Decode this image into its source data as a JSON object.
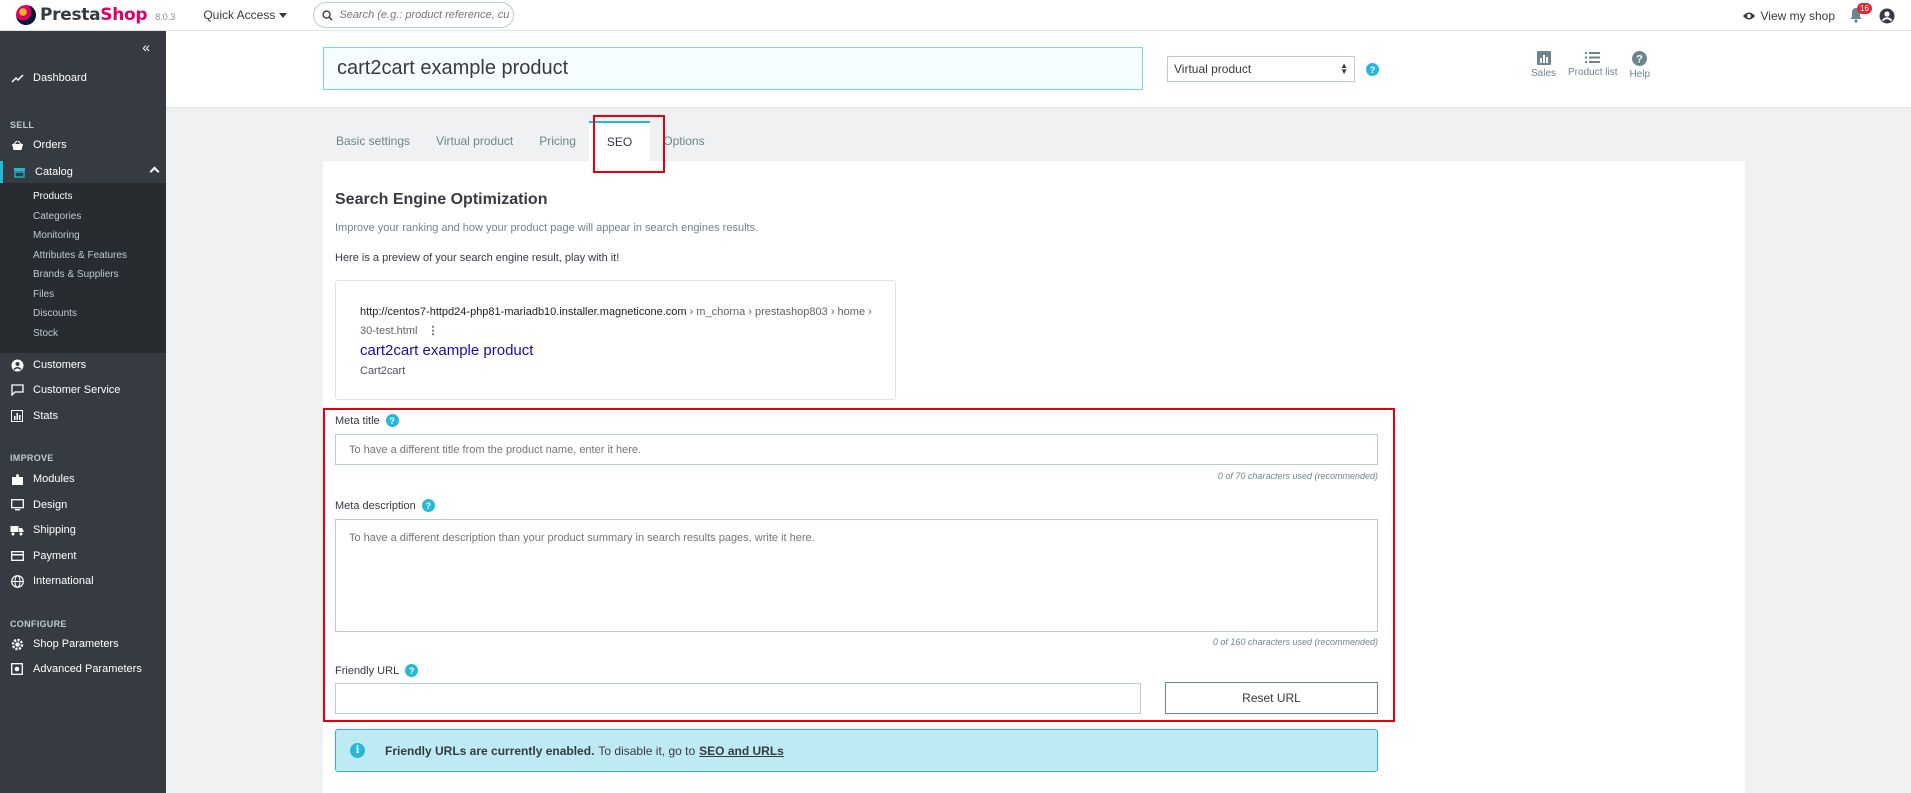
{
  "topbar": {
    "logo_prefix": "Presta",
    "logo_suffix": "Shop",
    "version": "8.0.3",
    "quick_access": "Quick Access",
    "search_placeholder": "Search (e.g.: product reference, custon",
    "view_shop": "View my shop",
    "notifications": "16"
  },
  "sidebar": {
    "dashboard": "Dashboard",
    "section_sell": "SELL",
    "orders": "Orders",
    "catalog": "Catalog",
    "catalog_items": [
      "Products",
      "Categories",
      "Monitoring",
      "Attributes & Features",
      "Brands & Suppliers",
      "Files",
      "Discounts",
      "Stock"
    ],
    "customers": "Customers",
    "customer_service": "Customer Service",
    "stats": "Stats",
    "section_improve": "IMPROVE",
    "modules": "Modules",
    "design": "Design",
    "shipping": "Shipping",
    "payment": "Payment",
    "international": "International",
    "section_configure": "CONFIGURE",
    "shop_parameters": "Shop Parameters",
    "advanced_parameters": "Advanced Parameters"
  },
  "product": {
    "name": "cart2cart example product",
    "type": "Virtual product",
    "actions": [
      "Sales",
      "Product list",
      "Help"
    ]
  },
  "tabs": [
    "Basic settings",
    "Virtual product",
    "Pricing",
    "SEO",
    "Options"
  ],
  "active_tab": "SEO",
  "seo": {
    "title": "Search Engine Optimization",
    "description": "Improve your ranking and how your product page will appear in search engines results.",
    "preview_lead": "Here is a preview of your search engine result, play with it!",
    "preview": {
      "url_domain": "http://centos7-httpd24-php81-mariadb10.installer.magneticone.com",
      "url_path": " › m_chorna › prestashop803 › home › 30-test.html",
      "title": "cart2cart example product",
      "description": "Cart2cart"
    },
    "meta_title_label": "Meta title",
    "meta_title_placeholder": "To have a different title from the product name, enter it here.",
    "meta_title_counter": "0 of 70 characters used (recommended)",
    "meta_description_label": "Meta description",
    "meta_description_placeholder": "To have a different description than your product summary in search results pages, write it here.",
    "meta_description_counter": "0 of 160 characters used (recommended)",
    "friendly_url_label": "Friendly URL",
    "friendly_url_value": "",
    "reset_url": "Reset URL",
    "alert_bold": "Friendly URLs are currently enabled.",
    "alert_text": "To disable it, go to",
    "alert_link": "SEO and URLs"
  },
  "colors": {
    "accent": "#25b9d7",
    "brand": "#df0067",
    "sidebar": "#363a41",
    "highlight": "#e3000f"
  }
}
